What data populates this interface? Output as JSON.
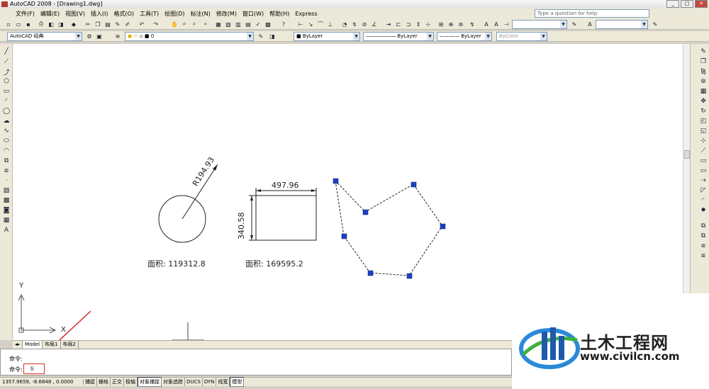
{
  "window": {
    "title": "AutoCAD 2008 - [Drawing1.dwg]",
    "min": "_",
    "restore": "□",
    "close": "✕"
  },
  "menu": {
    "items": [
      "文件(F)",
      "编辑(E)",
      "视图(V)",
      "插入(I)",
      "格式(O)",
      "工具(T)",
      "绘图(D)",
      "标注(N)",
      "修改(M)",
      "窗口(W)",
      "帮助(H)",
      "Express"
    ],
    "help_placeholder": "Type a question for help"
  },
  "toolbar": {
    "workspace": "AutoCAD 经典",
    "layer": "0",
    "color": "ByLayer",
    "linetype": "ByLayer",
    "lineweight": "ByLayer",
    "plotstyle": "ByColor"
  },
  "drawing": {
    "circle_radius_dim": "R194.93",
    "circle_area": "面积: 119312.8",
    "rect_width_dim": "497.96",
    "rect_height_dim": "340.58",
    "rect_area": "面积: 169595.2",
    "ucs_y": "Y",
    "ucs_x": "X"
  },
  "tabs": [
    "Model",
    "布局1",
    "布局2"
  ],
  "command": {
    "prompt_prev": "命令:",
    "prompt_current": "命令:",
    "input_value": "li"
  },
  "status": {
    "coords": "1357.9659, -8.6848 , 0.0000",
    "buttons": [
      {
        "label": "捕捉",
        "on": false
      },
      {
        "label": "栅格",
        "on": false
      },
      {
        "label": "正交",
        "on": false
      },
      {
        "label": "极轴",
        "on": false
      },
      {
        "label": "对象捕捉",
        "on": true
      },
      {
        "label": "对象追踪",
        "on": false
      },
      {
        "label": "DUCS",
        "on": false
      },
      {
        "label": "DYN",
        "on": false
      },
      {
        "label": "线宽",
        "on": false
      },
      {
        "label": "模型",
        "on": true
      }
    ]
  },
  "watermark": {
    "text": "土木工程网",
    "url": "www.civilcn.com"
  },
  "colors": {
    "grip": "#1f3fc8",
    "annotation_arrow": "#d8262a",
    "input_highlight": "#e0302a"
  }
}
